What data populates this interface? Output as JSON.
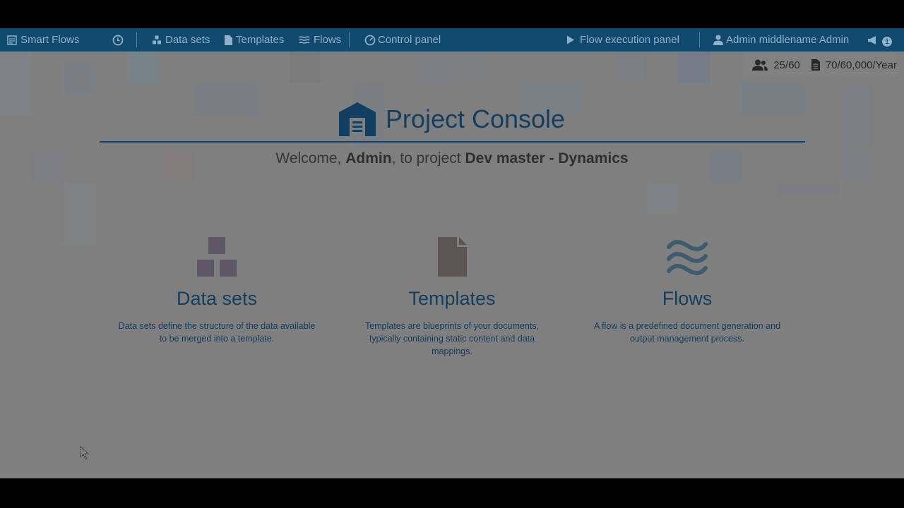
{
  "navbar": {
    "brand": "Smart Flows",
    "datasets": "Data sets",
    "templates": "Templates",
    "flows": "Flows",
    "control_panel": "Control panel",
    "flow_execution": "Flow execution panel",
    "user": "Admin middlename Admin",
    "notification_count": "1"
  },
  "quota": {
    "users": "25/60",
    "documents": "70/60,000/Year"
  },
  "header": {
    "title": "Project Console",
    "welcome_prefix": "Welcome,",
    "welcome_user": "Admin",
    "welcome_mid": ", to project",
    "project_name": "Dev master - Dynamics"
  },
  "cards": [
    {
      "title": "Data sets",
      "description": "Data sets define the structure of the data available to be merged into a template."
    },
    {
      "title": "Templates",
      "description": "Templates are blueprints of your documents, typically containing static content and data mappings."
    },
    {
      "title": "Flows",
      "description": "A flow is a predefined document generation and output management process."
    }
  ],
  "colors": {
    "navbar": "#114a6f",
    "accent": "#123f61",
    "overlay": "#7f7f7f"
  },
  "icons": [
    "smart-flows-logo-icon",
    "history-icon",
    "datasets-icon",
    "templates-icon",
    "flows-icon",
    "control-panel-icon",
    "play-icon",
    "user-icon",
    "megaphone-icon",
    "users-icon",
    "document-icon",
    "building-icon"
  ]
}
